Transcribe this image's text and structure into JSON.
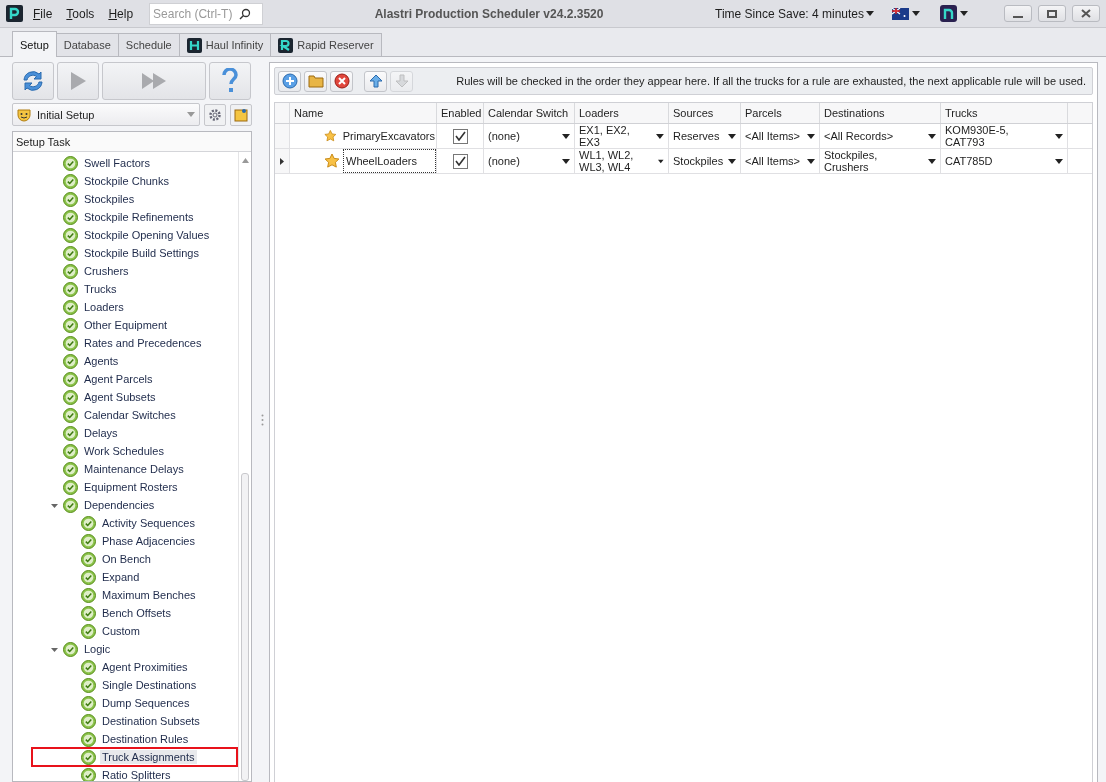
{
  "app": {
    "title": "Alastri Production Scheduler v24.2.3520",
    "menu": [
      "File",
      "Tools",
      "Help"
    ],
    "search": {
      "placeholder": "Search (Ctrl-T)"
    },
    "save_status": "Time Since Save: 4 minutes"
  },
  "tabs": [
    {
      "label": "Setup",
      "kind": "plain",
      "selected": true
    },
    {
      "label": "Database",
      "kind": "plain",
      "selected": false
    },
    {
      "label": "Schedule",
      "kind": "plain",
      "selected": false
    },
    {
      "label": "Haul Infinity",
      "kind": "haul",
      "selected": false
    },
    {
      "label": "Rapid Reserver",
      "kind": "rapid",
      "selected": false
    }
  ],
  "setup": {
    "actions": [
      {
        "kind": "refresh",
        "disabled": false
      },
      {
        "kind": "play",
        "disabled": true
      },
      {
        "kind": "fast",
        "disabled": true
      },
      {
        "kind": "help",
        "disabled": false
      }
    ],
    "profile": "Initial Setup",
    "tree_header": "Setup Task",
    "items": [
      {
        "label": "Swell Factors",
        "selected": false
      },
      {
        "label": "Stockpile Chunks",
        "selected": false
      },
      {
        "label": "Stockpiles",
        "selected": false
      },
      {
        "label": "Stockpile Refinements",
        "selected": false
      },
      {
        "label": "Stockpile Opening Values",
        "selected": false
      },
      {
        "label": "Stockpile Build Settings",
        "selected": false
      },
      {
        "label": "Crushers",
        "selected": false
      },
      {
        "label": "Trucks",
        "selected": false
      },
      {
        "label": "Loaders",
        "selected": false
      },
      {
        "label": "Other Equipment",
        "selected": false
      },
      {
        "label": "Rates and Precedences",
        "selected": false
      },
      {
        "label": "Agents",
        "selected": false
      },
      {
        "label": "Agent Parcels",
        "selected": false
      },
      {
        "label": "Agent Subsets",
        "selected": false
      },
      {
        "label": "Calendar Switches",
        "selected": false
      },
      {
        "label": "Delays",
        "selected": false
      },
      {
        "label": "Work Schedules",
        "selected": false
      },
      {
        "label": "Maintenance Delays",
        "selected": false
      },
      {
        "label": "Equipment Rosters",
        "selected": false
      },
      {
        "label": "Dependencies",
        "selected": false,
        "expanded": true,
        "children": [
          {
            "label": "Activity Sequences",
            "selected": false
          },
          {
            "label": "Phase Adjacencies",
            "selected": false
          },
          {
            "label": "On Bench",
            "selected": false
          },
          {
            "label": "Expand",
            "selected": false
          },
          {
            "label": "Maximum Benches",
            "selected": false
          },
          {
            "label": "Bench Offsets",
            "selected": false
          },
          {
            "label": "Custom",
            "selected": false
          }
        ]
      },
      {
        "label": "Logic",
        "selected": false,
        "expanded": true,
        "children": [
          {
            "label": "Agent Proximities",
            "selected": false
          },
          {
            "label": "Single Destinations",
            "selected": false
          },
          {
            "label": "Dump Sequences",
            "selected": false
          },
          {
            "label": "Destination Subsets",
            "selected": false
          },
          {
            "label": "Destination Rules",
            "selected": false
          },
          {
            "label": "Truck Assignments",
            "selected": true
          },
          {
            "label": "Ratio Splitters",
            "selected": false
          }
        ]
      }
    ]
  },
  "rules": {
    "actions": [
      {
        "kind": "add",
        "disabled": false
      },
      {
        "kind": "open",
        "disabled": false
      },
      {
        "kind": "delete",
        "disabled": false
      },
      {
        "kind": "up",
        "disabled": false
      },
      {
        "kind": "down",
        "disabled": true
      }
    ],
    "info": "Rules will be checked in the order they appear here. If all the trucks for a rule are exhausted, the next applicable rule will be used.",
    "columns": [
      "Name",
      "Enabled",
      "Calendar Switch",
      "Loaders",
      "Sources",
      "Parcels",
      "Destinations",
      "Trucks"
    ],
    "rows": [
      {
        "current": false,
        "enabled": true,
        "cells": [
          "PrimaryExcavators",
          "",
          "(none)",
          "EX1, EX2, EX3",
          "Reserves",
          "<All Items>",
          "<All Records>",
          "KOM930E-5, CAT793"
        ]
      },
      {
        "current": true,
        "enabled": true,
        "cells": [
          "WheelLoaders",
          "",
          "(none)",
          "WL1, WL2, WL3, WL4",
          "Stockpiles",
          "<All Items>",
          "Stockpiles, Crushers",
          "CAT785D"
        ]
      }
    ]
  }
}
